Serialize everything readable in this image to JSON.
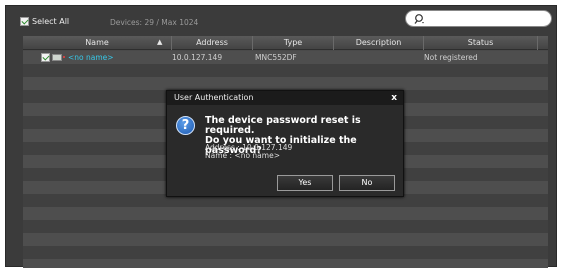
{
  "toolbar": {
    "select_all_label": "Select All",
    "select_all_checked": true,
    "devices_count": "Devices: 29 / Max 1024"
  },
  "search": {
    "placeholder": "",
    "value": ""
  },
  "table": {
    "columns": [
      "Name",
      "Address",
      "Type",
      "Description",
      "Status"
    ],
    "sort_column": "Name",
    "rows": [
      {
        "checked": true,
        "name": "<no name>",
        "address": "10.0.127.149",
        "type": "MNC552DF",
        "description": "",
        "status": "Not registered"
      }
    ]
  },
  "dialog": {
    "title": "User Authentication",
    "close_label": "x",
    "icon": "question-icon",
    "message_line1": "The device password reset is required.",
    "message_line2": "Do you want to initialize the password?",
    "address_line": "Address : 10.0.127.149",
    "name_line": "Name : <no name>",
    "yes_label": "Yes",
    "no_label": "No"
  },
  "colors": {
    "background": "#3b3b3b",
    "link": "#37c8e8",
    "dialog": "#2a2a2a",
    "question_icon": "#2f77d1"
  }
}
